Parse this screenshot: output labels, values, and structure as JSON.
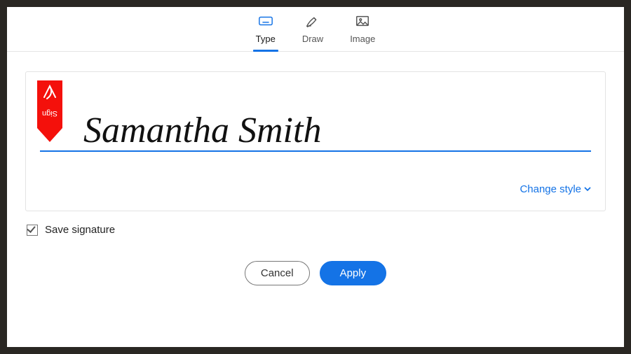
{
  "tabs": {
    "type": "Type",
    "draw": "Draw",
    "image": "Image",
    "active": "type"
  },
  "signature": {
    "text": "Samantha Smith",
    "bookmark_label": "Sign",
    "change_style": "Change style"
  },
  "save": {
    "label": "Save signature",
    "checked": true
  },
  "actions": {
    "cancel": "Cancel",
    "apply": "Apply"
  },
  "colors": {
    "accent": "#1473e6",
    "bookmark": "#f4100b"
  }
}
